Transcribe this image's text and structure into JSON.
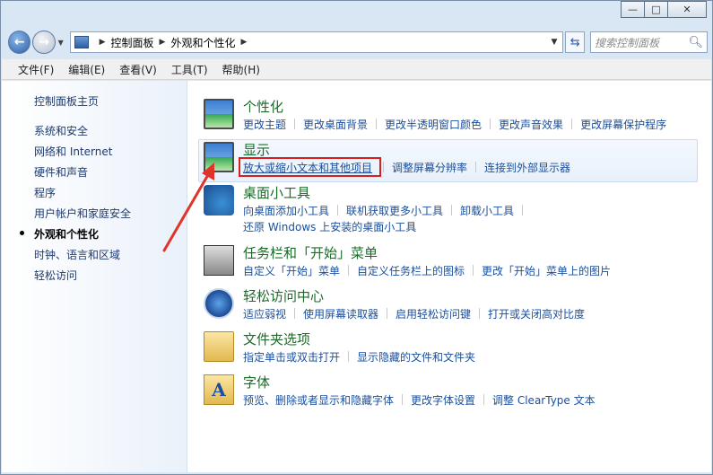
{
  "window": {
    "minimize_glyph": "—",
    "maximize_glyph": "□",
    "close_glyph": "✕"
  },
  "address": {
    "crumbs": [
      "控制面板",
      "外观和个性化"
    ],
    "search_placeholder": "搜索控制面板"
  },
  "menu": [
    "文件(F)",
    "编辑(E)",
    "查看(V)",
    "工具(T)",
    "帮助(H)"
  ],
  "sidebar": {
    "items": [
      {
        "label": "控制面板主页",
        "active": false
      },
      {
        "label": "系统和安全",
        "active": false
      },
      {
        "label": "网络和 Internet",
        "active": false
      },
      {
        "label": "硬件和声音",
        "active": false
      },
      {
        "label": "程序",
        "active": false
      },
      {
        "label": "用户帐户和家庭安全",
        "active": false
      },
      {
        "label": "外观和个性化",
        "active": true
      },
      {
        "label": "时钟、语言和区域",
        "active": false
      },
      {
        "label": "轻松访问",
        "active": false
      }
    ]
  },
  "categories": [
    {
      "title": "个性化",
      "icon": "personalization-icon",
      "links": [
        "更改主题",
        "更改桌面背景",
        "更改半透明窗口颜色",
        "更改声音效果",
        "更改屏幕保护程序"
      ],
      "links2": []
    },
    {
      "title": "显示",
      "icon": "display-icon",
      "links": [
        "放大或缩小文本和其他项目",
        "调整屏幕分辨率",
        "连接到外部显示器"
      ],
      "links2": []
    },
    {
      "title": "桌面小工具",
      "icon": "gadgets-icon",
      "links": [
        "向桌面添加小工具",
        "联机获取更多小工具",
        "卸载小工具"
      ],
      "links2": [
        "还原 Windows 上安装的桌面小工具"
      ]
    },
    {
      "title": "任务栏和「开始」菜单",
      "icon": "taskbar-icon",
      "links": [
        "自定义「开始」菜单",
        "自定义任务栏上的图标",
        "更改「开始」菜单上的图片"
      ],
      "links2": []
    },
    {
      "title": "轻松访问中心",
      "icon": "ease-of-access-icon",
      "links": [
        "适应弱视",
        "使用屏幕读取器",
        "启用轻松访问键",
        "打开或关闭高对比度"
      ],
      "links2": []
    },
    {
      "title": "文件夹选项",
      "icon": "folder-options-icon",
      "links": [
        "指定单击或双击打开",
        "显示隐藏的文件和文件夹"
      ],
      "links2": []
    },
    {
      "title": "字体",
      "icon": "fonts-icon",
      "links": [
        "预览、删除或者显示和隐藏字体",
        "更改字体设置",
        "调整 ClearType 文本"
      ],
      "links2": []
    }
  ],
  "colors": {
    "category_title": "#1a6b28",
    "link": "#1a4f9c",
    "highlight_box": "#d62020"
  }
}
